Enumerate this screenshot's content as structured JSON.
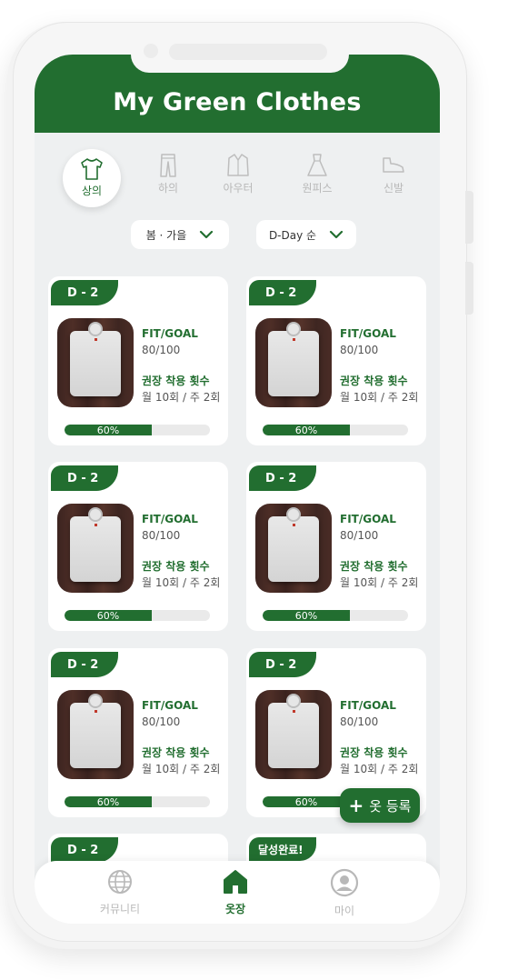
{
  "app": {
    "title": "My Green Clothes"
  },
  "colors": {
    "brand": "#226e30",
    "background": "#eef0f1"
  },
  "categories": [
    {
      "label": "상의",
      "icon": "tshirt-icon",
      "active": true
    },
    {
      "label": "하의",
      "icon": "pants-icon",
      "active": false
    },
    {
      "label": "아우터",
      "icon": "jacket-icon",
      "active": false
    },
    {
      "label": "원피스",
      "icon": "dress-icon",
      "active": false
    },
    {
      "label": "신발",
      "icon": "shoe-icon",
      "active": false
    }
  ],
  "filters": {
    "season": {
      "value": "봄 · 가을",
      "icon": "chevron-down-icon"
    },
    "sort": {
      "value": "D-Day 순",
      "icon": "chevron-down-icon"
    }
  },
  "cards": [
    {
      "badge": "D - 2",
      "fit_label": "FIT/GOAL",
      "fit_value": "80/100",
      "rec_label": "권장 착용 횟수",
      "rec_value": "월 10회 / 주 2회",
      "progress": 0.6,
      "progress_label": "60%"
    },
    {
      "badge": "D - 2",
      "fit_label": "FIT/GOAL",
      "fit_value": "80/100",
      "rec_label": "권장 착용 횟수",
      "rec_value": "월 10회 / 주 2회",
      "progress": 0.6,
      "progress_label": "60%"
    },
    {
      "badge": "D - 2",
      "fit_label": "FIT/GOAL",
      "fit_value": "80/100",
      "rec_label": "권장 착용 횟수",
      "rec_value": "월 10회 / 주 2회",
      "progress": 0.6,
      "progress_label": "60%"
    },
    {
      "badge": "D - 2",
      "fit_label": "FIT/GOAL",
      "fit_value": "80/100",
      "rec_label": "권장 착용 횟수",
      "rec_value": "월 10회 / 주 2회",
      "progress": 0.6,
      "progress_label": "60%"
    },
    {
      "badge": "D - 2",
      "fit_label": "FIT/GOAL",
      "fit_value": "80/100",
      "rec_label": "권장 착용 횟수",
      "rec_value": "월 10회 / 주 2회",
      "progress": 0.6,
      "progress_label": "60%"
    },
    {
      "badge": "D - 2",
      "fit_label": "FIT/GOAL",
      "fit_value": "80/100",
      "rec_label": "권장 착용 횟수",
      "rec_value": "월 10회 / 주 2회",
      "progress": 0.6,
      "progress_label": "60%"
    },
    {
      "badge": "D - 2"
    },
    {
      "badge": "달성완료!"
    }
  ],
  "fab": {
    "label": "옷 등록",
    "icon": "plus-icon"
  },
  "tabbar": [
    {
      "label": "커뮤니티",
      "icon": "globe-icon",
      "active": false
    },
    {
      "label": "옷장",
      "icon": "home-icon",
      "active": true
    },
    {
      "label": "마이",
      "icon": "profile-icon",
      "active": false
    }
  ]
}
